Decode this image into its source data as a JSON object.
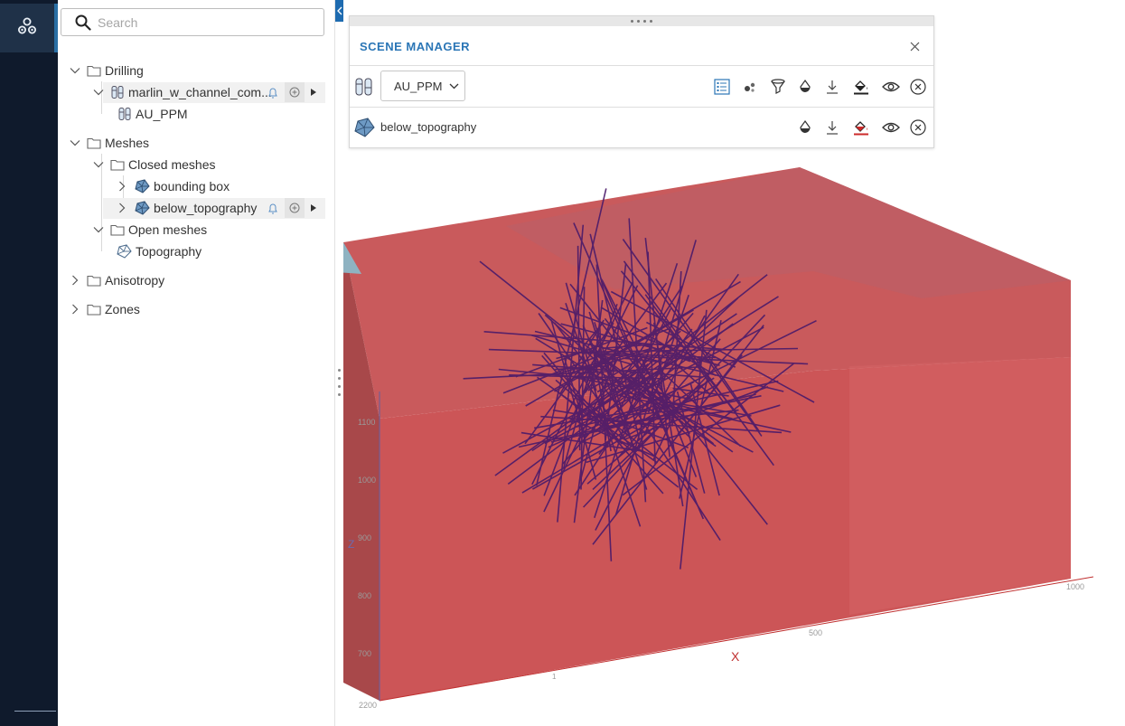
{
  "rail": {
    "active_icon": "objects-icon"
  },
  "search": {
    "placeholder": "Search",
    "value": ""
  },
  "tree": {
    "drilling": "Drilling",
    "drillhole_set": "marlin_w_channel_com...",
    "drillhole_attr": "AU_PPM",
    "meshes": "Meshes",
    "closed_meshes": "Closed meshes",
    "bounding_box": "bounding box",
    "below_topography": "below_topography",
    "open_meshes": "Open meshes",
    "topography": "Topography",
    "anisotropy": "Anisotropy",
    "zones": "Zones"
  },
  "scene_manager": {
    "title": "SCENE MANAGER",
    "row1_selected": "AU_PPM",
    "row2_label": "below_topography"
  },
  "viewport": {
    "axis_x_label": "X",
    "axis_z_label": "Z",
    "z_ticks": [
      "1100",
      "1000",
      "900",
      "800",
      "700"
    ],
    "x_ticks": [
      "500",
      "1000"
    ],
    "corner_label": "2200",
    "small_tick": "1"
  },
  "colors": {
    "accent": "#2b76b6",
    "mesh": "#c94d4f",
    "drill_lines": "#4a1a6a",
    "rail": "#0f1a2c",
    "arrow": "#8fb3c2"
  }
}
